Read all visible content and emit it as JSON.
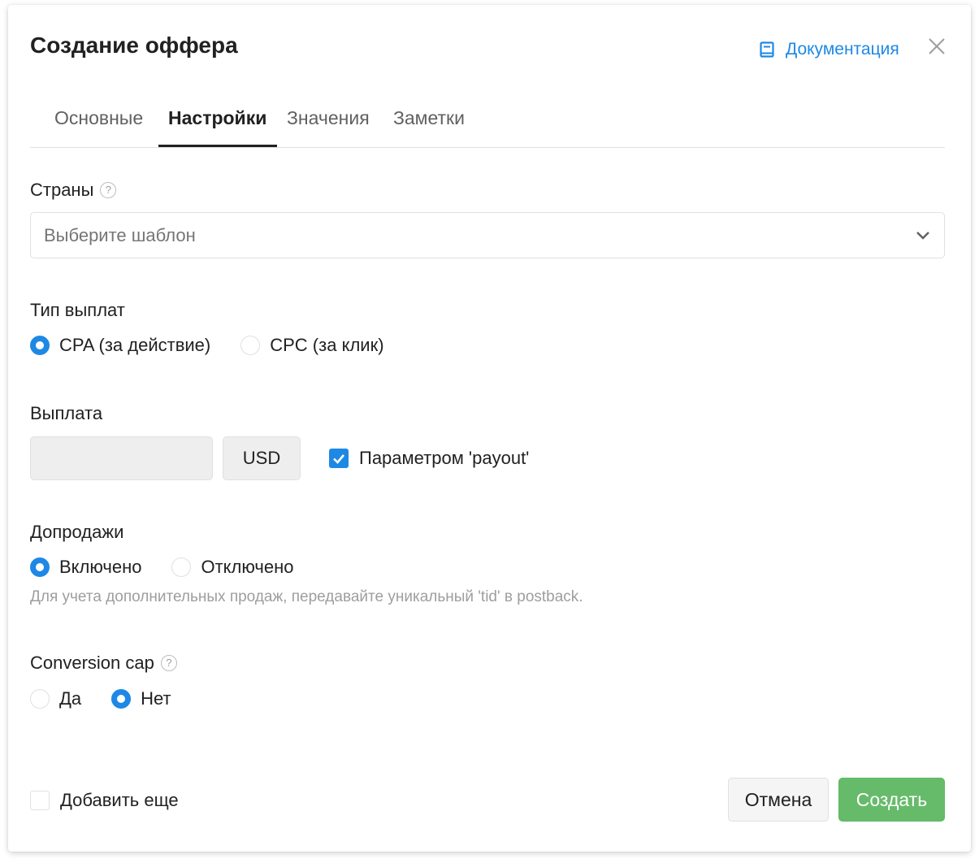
{
  "dialog": {
    "title": "Создание оффера",
    "doc_link_label": "Документация",
    "accent_color": "#1e88e5",
    "success_color": "#66bb6a"
  },
  "tabs": [
    {
      "label": "Основные",
      "active": false
    },
    {
      "label": "Настройки",
      "active": true
    },
    {
      "label": "Значения",
      "active": false
    },
    {
      "label": "Заметки",
      "active": false
    }
  ],
  "countries": {
    "label": "Страны",
    "placeholder": "Выберите шаблон"
  },
  "payout_type": {
    "label": "Тип выплат",
    "options": [
      {
        "label": "CPA (за действие)",
        "selected": true
      },
      {
        "label": "CPC (за клик)",
        "selected": false
      }
    ]
  },
  "payout": {
    "label": "Выплата",
    "value": "",
    "currency": "USD",
    "param_checkbox_label": "Параметром 'payout'",
    "param_checked": true
  },
  "upsells": {
    "label": "Допродажи",
    "options": [
      {
        "label": "Включено",
        "selected": true
      },
      {
        "label": "Отключено",
        "selected": false
      }
    ],
    "hint": "Для учета дополнительных продаж, передавайте уникальный 'tid' в postback."
  },
  "conversion_cap": {
    "label": "Conversion cap",
    "options": [
      {
        "label": "Да",
        "selected": false
      },
      {
        "label": "Нет",
        "selected": true
      }
    ]
  },
  "footer": {
    "add_more_label": "Добавить еще",
    "add_more_checked": false,
    "cancel_label": "Отмена",
    "create_label": "Создать"
  },
  "icons": [
    "book-icon",
    "close-icon",
    "help-icon",
    "chevron-down-icon",
    "check-icon"
  ]
}
